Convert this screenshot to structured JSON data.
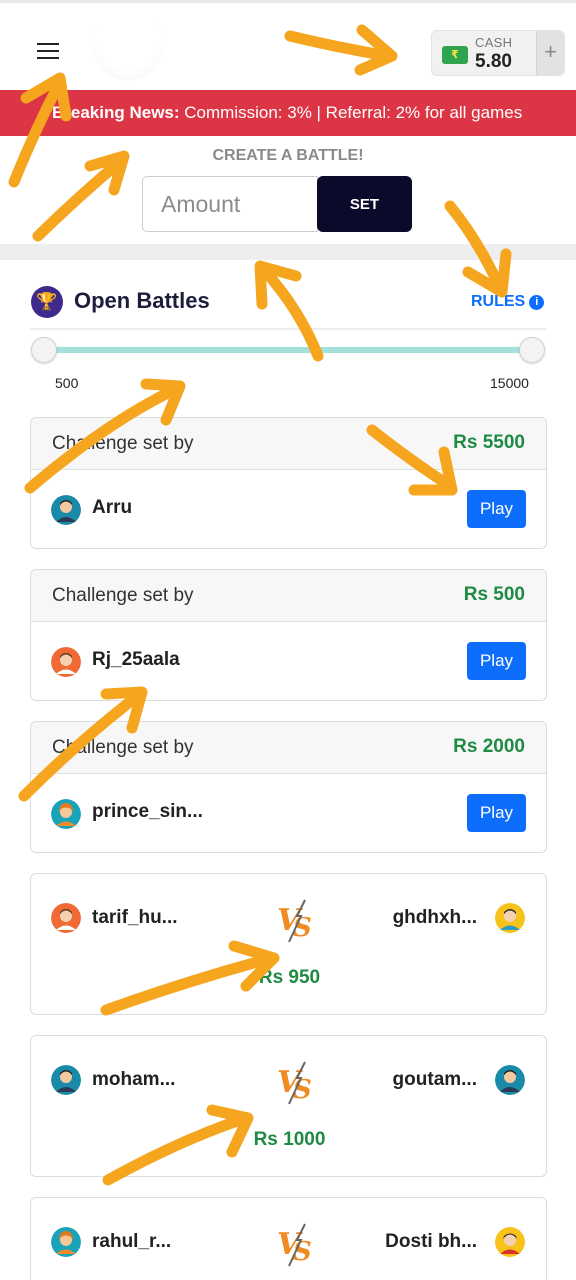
{
  "header": {
    "wallet": {
      "label": "CASH",
      "value": "5.80",
      "add_symbol": "+",
      "icon": "cash-icon"
    }
  },
  "news": {
    "prefix": "Breaking News:",
    "text": "Commission: 3% | Referral: 2% for all games"
  },
  "create_battle": {
    "title": "CREATE A BATTLE!",
    "amount_placeholder": "Amount",
    "set_label": "SET"
  },
  "open_battles": {
    "title": "Open Battles",
    "icon": "trophy-icon",
    "rules_label": "RULES",
    "slider": {
      "min_label": "500",
      "max_label": "15000",
      "selected_min": 500,
      "selected_max": 15000
    },
    "challenges": [
      {
        "set_by": "Challenge set by",
        "amount": "Rs 5500",
        "user": "Arru",
        "play": "Play"
      },
      {
        "set_by": "Challenge set by",
        "amount": "Rs 500",
        "user": "Rj_25aala",
        "play": "Play"
      },
      {
        "set_by": "Challenge set by",
        "amount": "Rs 2000",
        "user": "prince_sin...",
        "play": "Play"
      }
    ]
  },
  "running_battles": [
    {
      "player1": "tarif_hu...",
      "player2": "ghdhxh...",
      "amount": "Rs 950"
    },
    {
      "player1": "moham...",
      "player2": "goutam...",
      "amount": "Rs 1000"
    },
    {
      "player1": "rahul_r...",
      "player2": "Dosti bh...",
      "amount": ""
    }
  ],
  "colors": {
    "news_bg": "#dc3545",
    "set_button": "#0b0a2a",
    "play_button": "#0d6efd",
    "amount_green": "#1f8a43",
    "arrow": "#f5a51e"
  }
}
